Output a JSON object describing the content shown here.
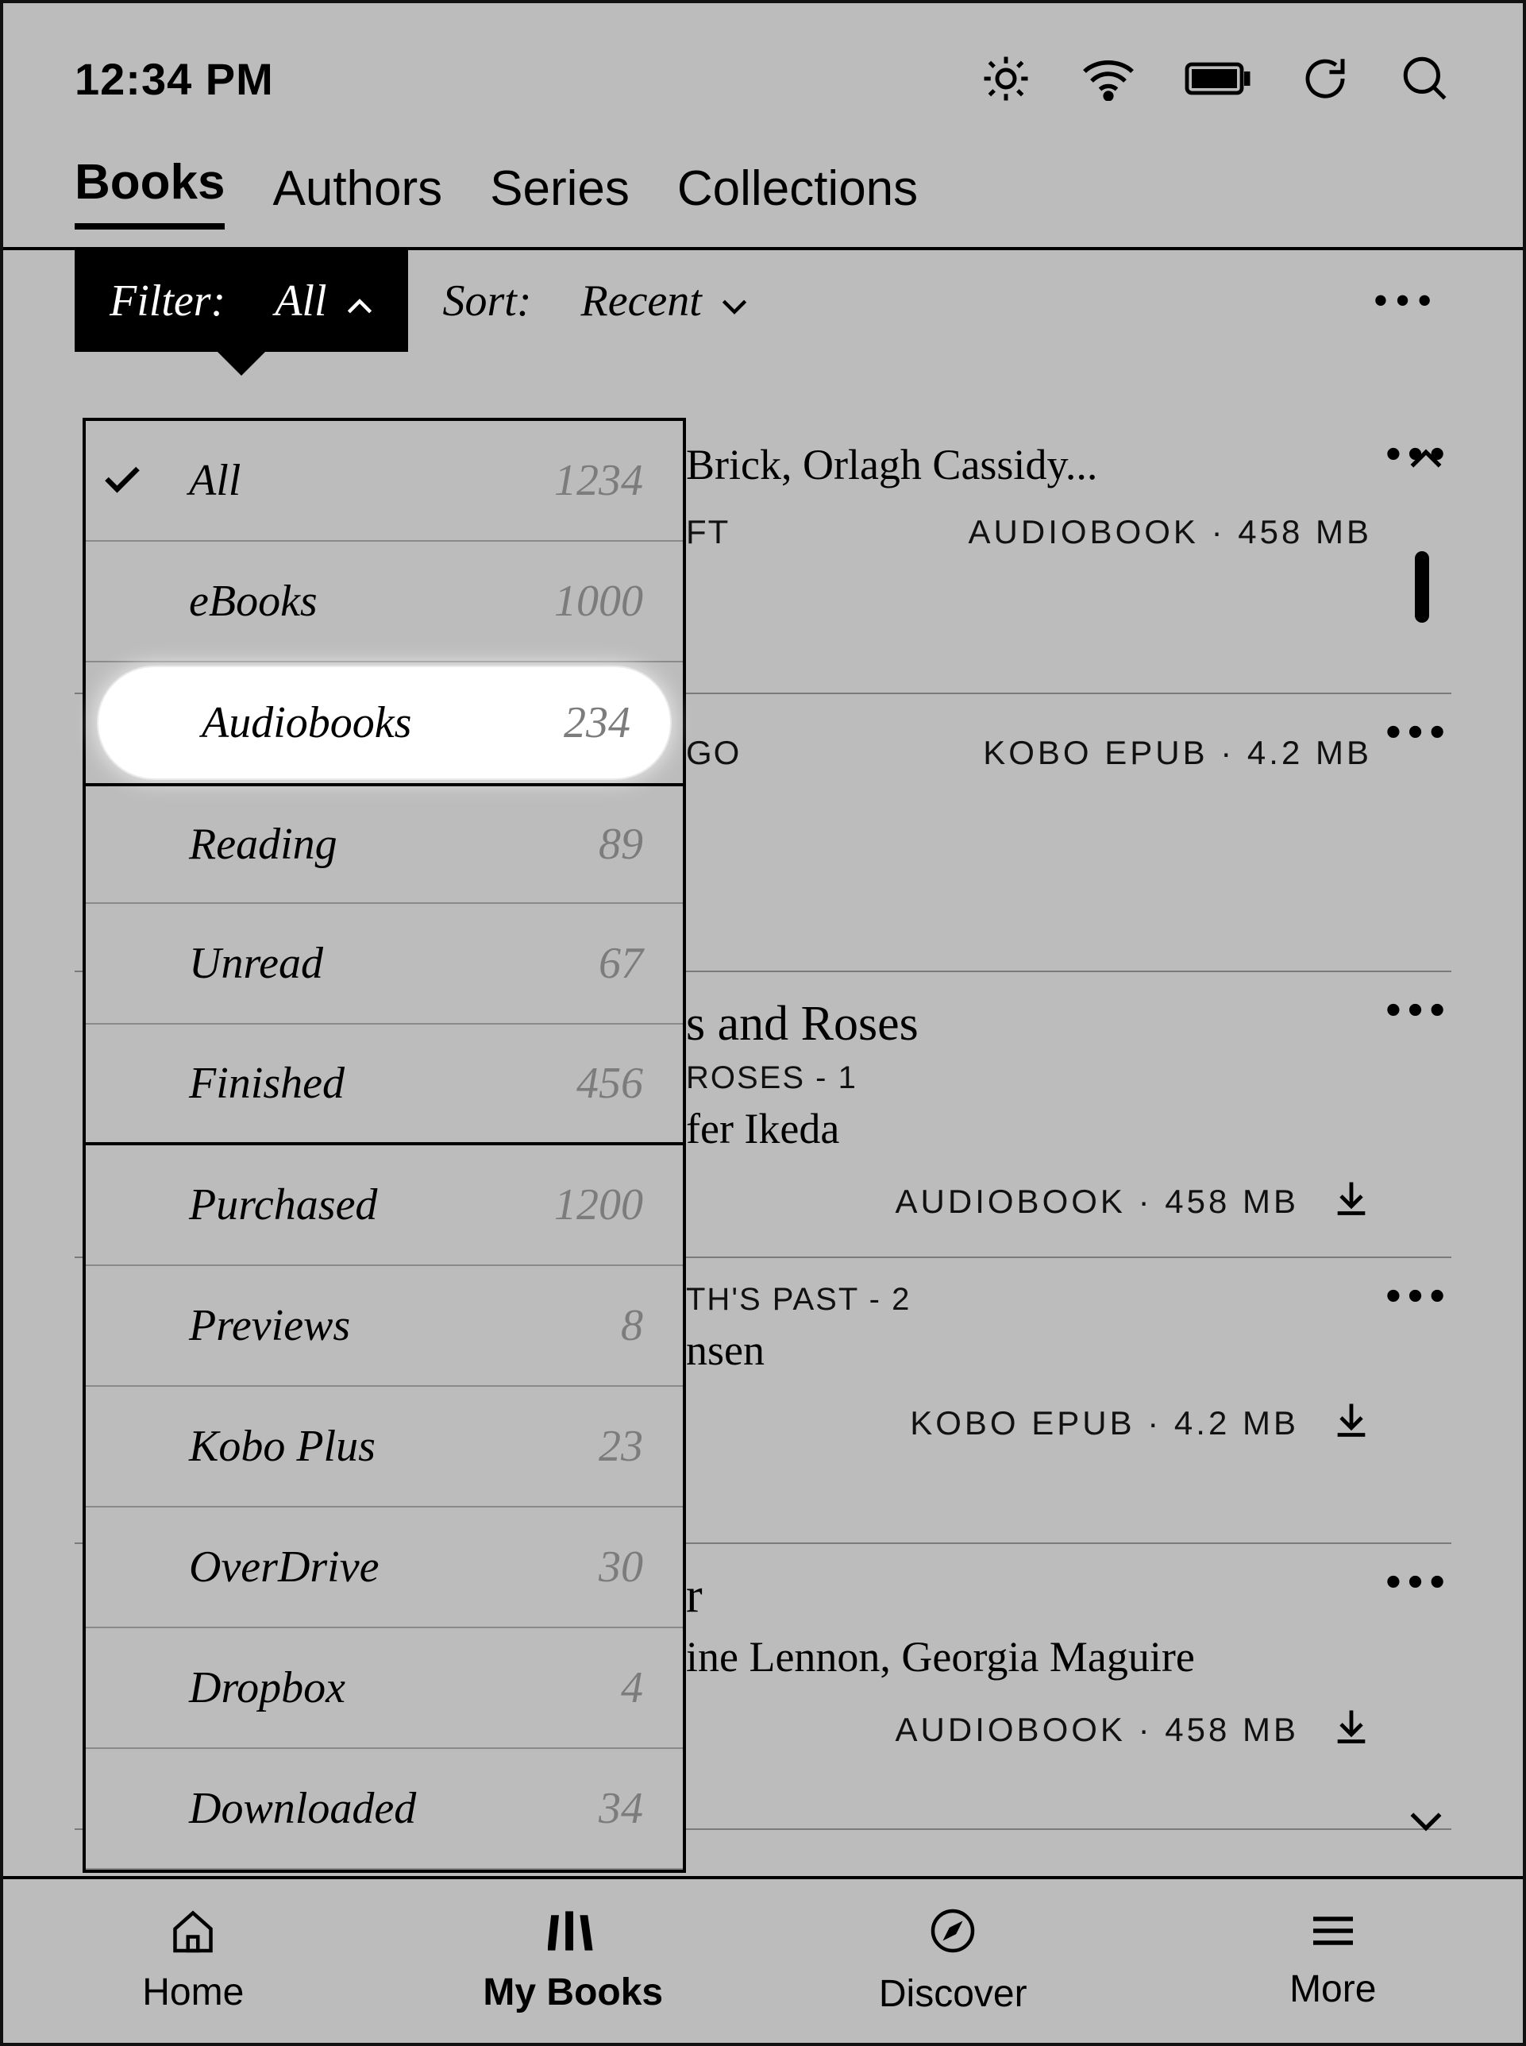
{
  "status": {
    "time": "12:34 PM"
  },
  "tabs": [
    "Books",
    "Authors",
    "Series",
    "Collections"
  ],
  "activeTab": 0,
  "filter": {
    "label": "Filter:",
    "value": "All"
  },
  "sort": {
    "label": "Sort:",
    "value": "Recent"
  },
  "dropdown": [
    {
      "label": "All",
      "count": "1234",
      "selected": true,
      "section_end": false
    },
    {
      "label": "eBooks",
      "count": "1000",
      "selected": false,
      "section_end": false
    },
    {
      "label": "Audiobooks",
      "count": "234",
      "selected": false,
      "section_end": false,
      "highlight": true
    },
    {
      "label": "Reading",
      "count": "89",
      "selected": false,
      "section_end": false
    },
    {
      "label": "Unread",
      "count": "67",
      "selected": false,
      "section_end": false
    },
    {
      "label": "Finished",
      "count": "456",
      "selected": false,
      "section_end": true
    },
    {
      "label": "Purchased",
      "count": "1200",
      "selected": false,
      "section_end": false
    },
    {
      "label": "Previews",
      "count": "8",
      "selected": false,
      "section_end": false
    },
    {
      "label": "Kobo Plus",
      "count": "23",
      "selected": false,
      "section_end": false
    },
    {
      "label": "OverDrive",
      "count": "30",
      "selected": false,
      "section_end": false
    },
    {
      "label": "Dropbox",
      "count": "4",
      "selected": false,
      "section_end": false
    },
    {
      "label": "Downloaded",
      "count": "34",
      "selected": false,
      "section_end": false
    }
  ],
  "books": [
    {
      "title": "",
      "series": "",
      "narrator": "Brick, Orlagh Cassidy...",
      "left_meta": "FT",
      "right_meta": "AUDIOBOOK · 458 MB",
      "download": false
    },
    {
      "title": "",
      "series": "",
      "narrator": "",
      "left_meta": "GO",
      "right_meta": "KOBO EPUB · 4.2 MB",
      "download": false
    },
    {
      "title": "s and Roses",
      "series": "ROSES - 1",
      "narrator": "fer Ikeda",
      "left_meta": "",
      "right_meta": "AUDIOBOOK · 458 MB",
      "download": true
    },
    {
      "title": "",
      "series": "TH'S PAST - 2",
      "narrator": "nsen",
      "left_meta": "",
      "right_meta": "KOBO EPUB · 4.2 MB",
      "download": true
    },
    {
      "title": "r",
      "series": "",
      "narrator": "ine Lennon, Georgia Maguire",
      "left_meta": "",
      "right_meta": "AUDIOBOOK · 458 MB",
      "download": true
    }
  ],
  "nav": [
    "Home",
    "My Books",
    "Discover",
    "More"
  ],
  "activeNav": 1
}
